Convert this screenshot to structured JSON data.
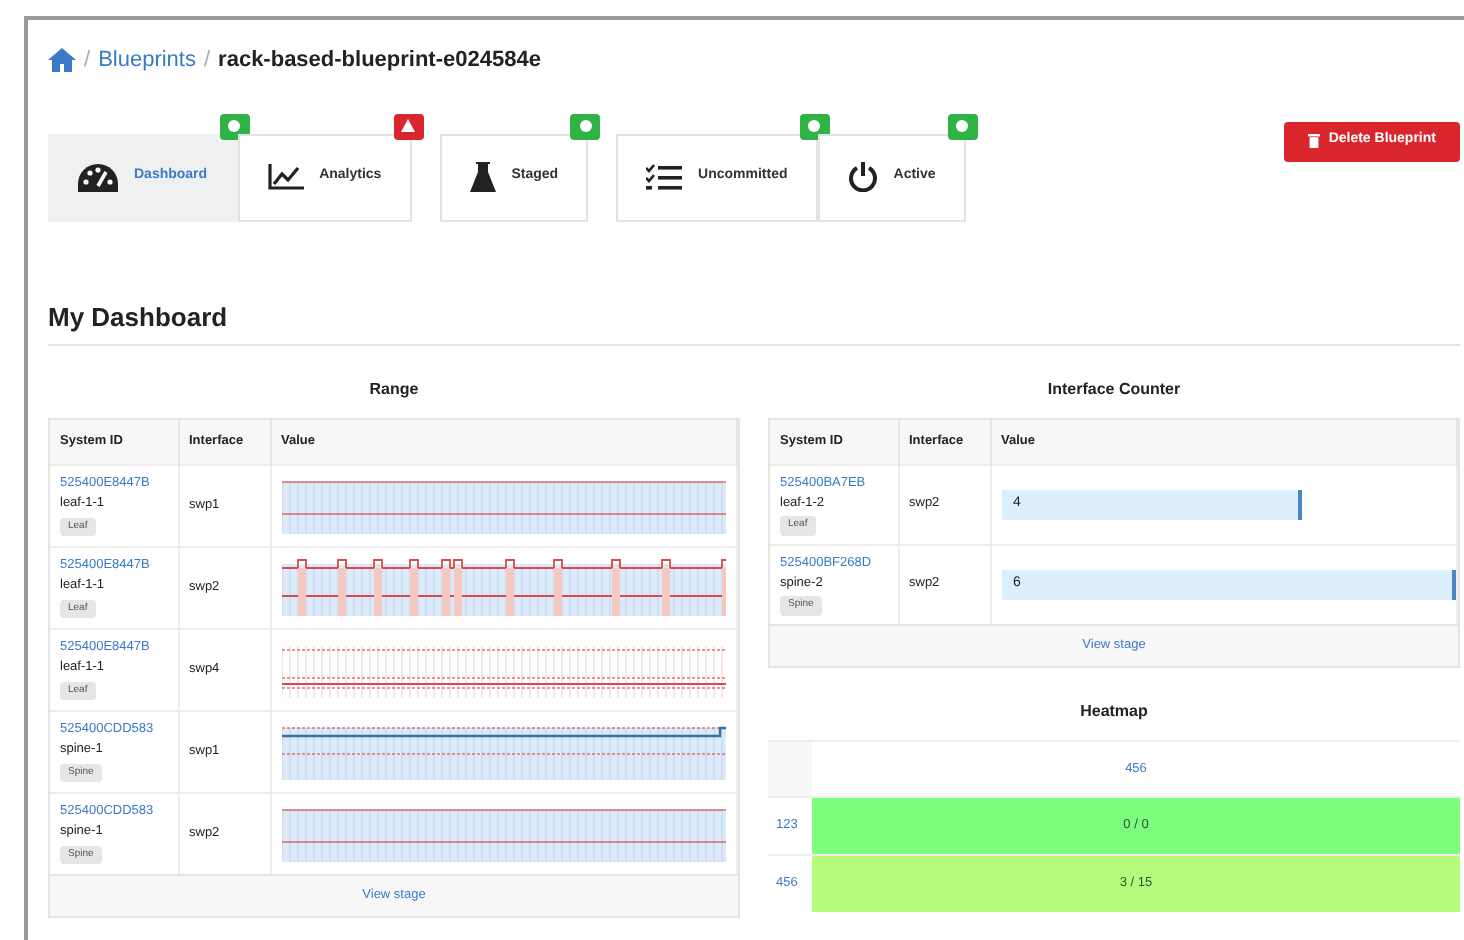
{
  "breadcrumb": {
    "items": [
      {
        "kind": "separator",
        "text": "/"
      },
      {
        "kind": "link",
        "text": "Blueprints"
      },
      {
        "kind": "separator",
        "text": "/"
      }
    ],
    "current": "rack-based-blueprint-e024584e"
  },
  "tabs": [
    {
      "label": "Dashboard",
      "kind": "gauge",
      "selected": true,
      "warning": false
    },
    {
      "label": "Analytics",
      "kind": "chart",
      "selected": false,
      "warning": true
    },
    {
      "label": "Staged",
      "kind": "flask",
      "selected": false,
      "warning": false
    },
    {
      "label": "Uncommitted",
      "kind": "list",
      "selected": false,
      "warning": false
    },
    {
      "label": "Active",
      "kind": "power",
      "selected": false,
      "warning": false
    }
  ],
  "delete_button": "Delete Blueprint",
  "heading": "My Dashboard",
  "range": {
    "title": "Range",
    "columns": [
      "System ID",
      "Interface",
      "Value"
    ],
    "rows": [
      {
        "system_id": "525400E8447B",
        "name": "leaf-1-1",
        "role": "Leaf",
        "interface": "swp1",
        "kind": "flat"
      },
      {
        "system_id": "525400E8447B",
        "name": "leaf-1-1",
        "role": "Leaf",
        "interface": "swp2",
        "kind": "pulses"
      },
      {
        "system_id": "525400E8447B",
        "name": "leaf-1-1",
        "role": "Leaf",
        "interface": "swp4",
        "kind": "empty"
      },
      {
        "system_id": "525400CDD583",
        "name": "spine-1",
        "role": "Spine",
        "interface": "swp1",
        "kind": "step"
      },
      {
        "system_id": "525400CDD583",
        "name": "spine-1",
        "role": "Spine",
        "interface": "swp2",
        "kind": "flat"
      }
    ],
    "link": "View stage"
  },
  "counter": {
    "title": "Interface Counter",
    "columns": [
      "System ID",
      "Interface",
      "Value"
    ],
    "rows": [
      {
        "system_id": "525400BA7EB",
        "name": "leaf-1-2",
        "role": "Leaf",
        "interface": "swp2",
        "value": "4",
        "level": 0.66
      },
      {
        "system_id": "525400BF268D",
        "name": "spine-2",
        "role": "Spine",
        "interface": "swp2",
        "value": "6",
        "level": 1.0
      }
    ],
    "link": "View stage"
  },
  "heatmap": {
    "title": "Heatmap",
    "column": "456",
    "rows": [
      {
        "label": "123",
        "value": "0 / 0",
        "color": "#7dfc7d"
      },
      {
        "label": "456",
        "value": "3 / 15",
        "color": "#b5fc7d"
      }
    ]
  }
}
